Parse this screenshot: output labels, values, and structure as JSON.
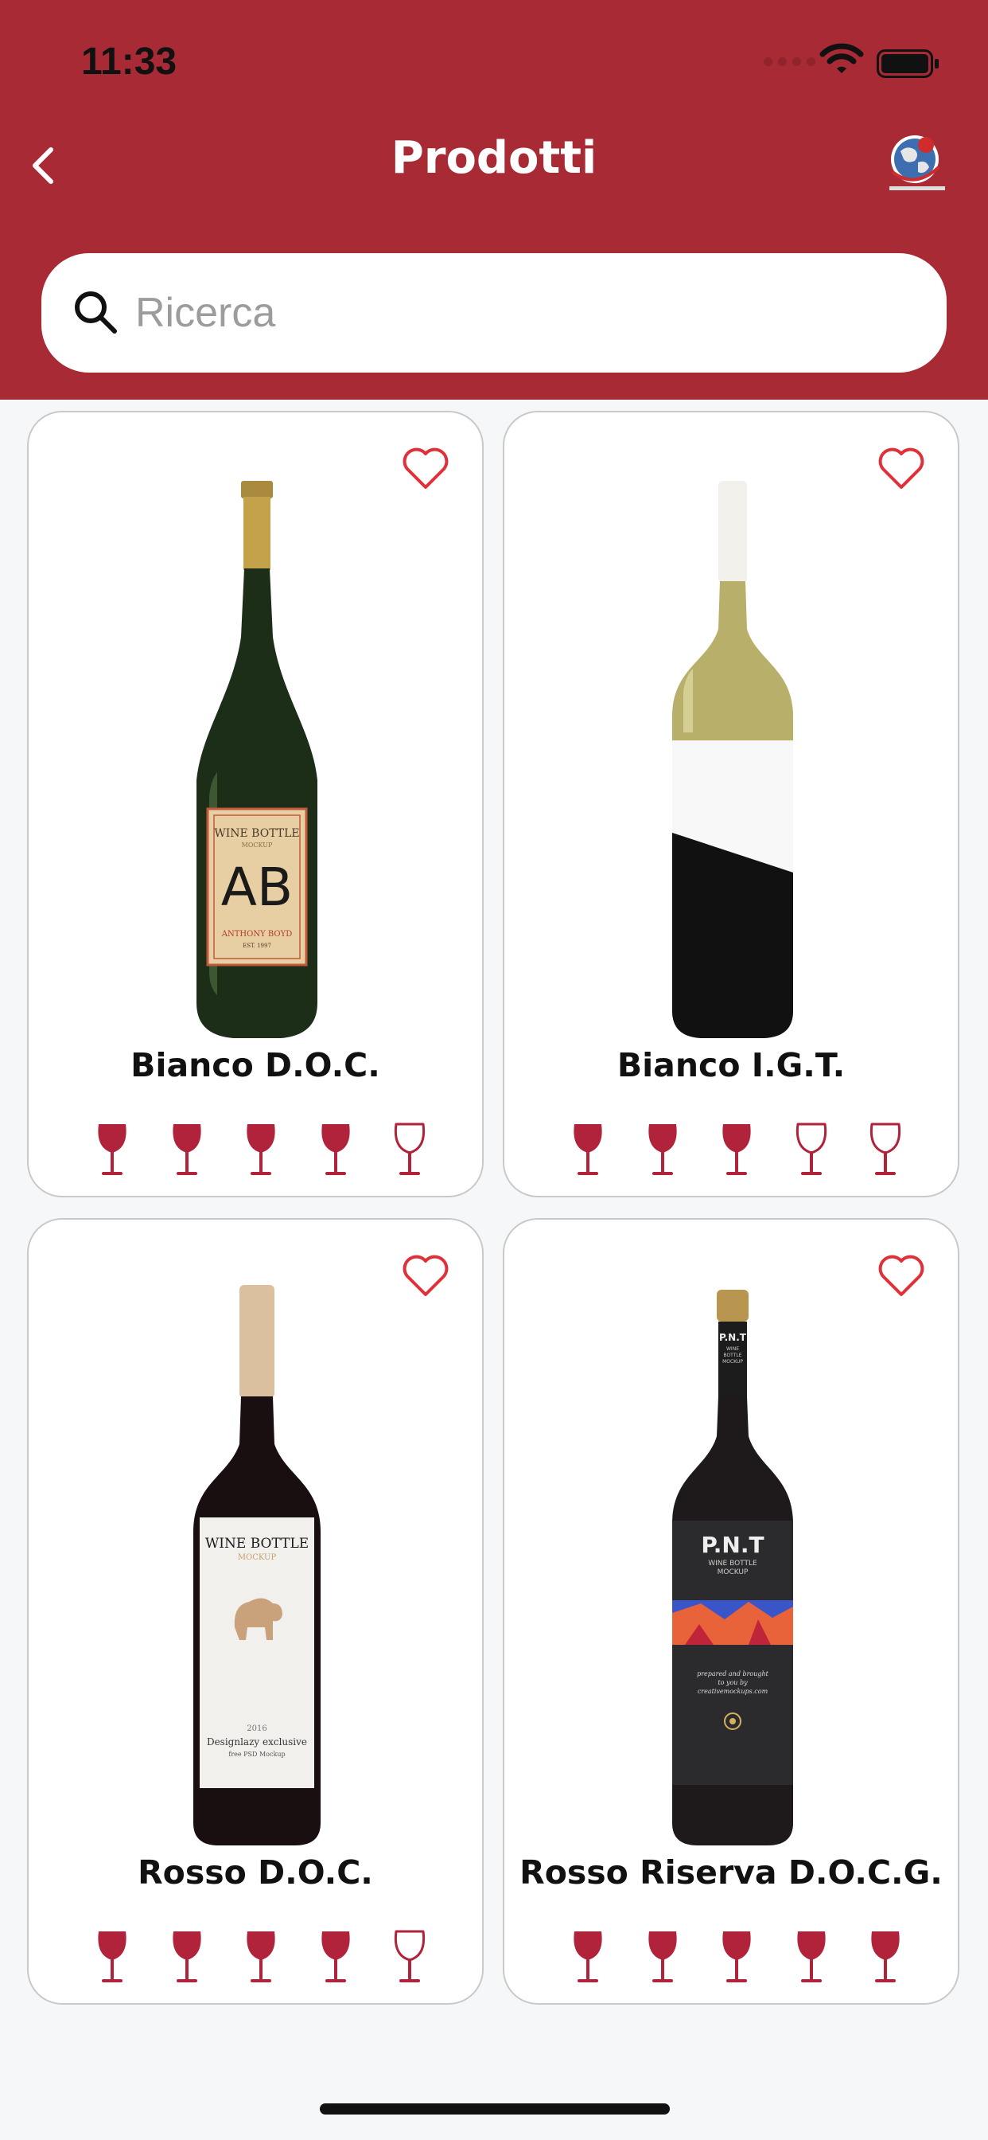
{
  "status_bar": {
    "time": "11:33"
  },
  "header": {
    "title": "Prodotti"
  },
  "search": {
    "placeholder": "Ricerca",
    "value": ""
  },
  "colors": {
    "brand": "#a82a35",
    "heart": "#e0303a",
    "glass": "#b0233a",
    "background": "#f6f7f9"
  },
  "products": [
    {
      "name": "Bianco D.O.C.",
      "rating": 4,
      "max_rating": 5,
      "favorite": false
    },
    {
      "name": "Bianco I.G.T.",
      "rating": 3,
      "max_rating": 5,
      "favorite": false
    },
    {
      "name": "Rosso D.O.C.",
      "rating": 4,
      "max_rating": 5,
      "favorite": false
    },
    {
      "name": "Rosso Riserva D.O.C.G.",
      "rating": 5,
      "max_rating": 5,
      "favorite": false
    }
  ],
  "bottle_labels": {
    "p0": {
      "line1": "WINE BOTTLE",
      "line2": "MOCKUP",
      "monogram": "AB",
      "maker": "ANTHONY BOYD",
      "year": "EST. 1997"
    },
    "p2": {
      "line1": "WINE BOTTLE",
      "line2": "MOCKUP",
      "year": "2016",
      "maker": "Designlazy exclusive",
      "sub": "free PSD Mockup"
    },
    "p3": {
      "neck": "P.N.T",
      "neck2": "WINE",
      "neck3": "BOTTLE",
      "neck4": "MOCKUP",
      "brand": "P.N.T",
      "line1": "WINE BOTTLE",
      "line2": "MOCKUP",
      "tag1": "prepared and brought",
      "tag2": "to you by",
      "tag3": "creativemockups.com"
    }
  }
}
